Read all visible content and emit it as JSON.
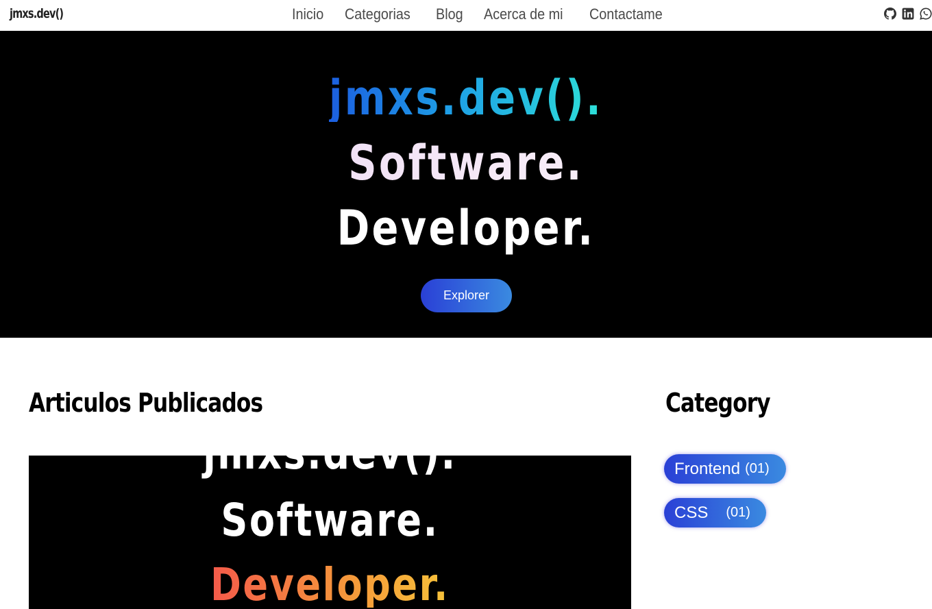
{
  "nav": {
    "brand": "jmxs.dev()",
    "links": [
      "Inicio",
      "Categorias",
      "Blog",
      "Acerca de mi",
      "Contactame"
    ],
    "icons": [
      "github-icon",
      "linkedin-icon",
      "whatsapp-icon"
    ]
  },
  "hero": {
    "line1": "jmxs.dev().",
    "line2": "Software.",
    "line3": "Developer.",
    "button": "Explorer"
  },
  "articles": {
    "title": "Articulos Publicados",
    "card": {
      "line1": "jmxs.dev().",
      "line2": "Software.",
      "line3": "Developer."
    }
  },
  "categories": {
    "title": "Category",
    "items": [
      {
        "name": "Frontend",
        "count": "(01)"
      },
      {
        "name": "CSS",
        "count": "(01)"
      }
    ]
  },
  "colors": {
    "hero_background": "#000000",
    "button_gradient_start": "#2a40d6",
    "button_gradient_end": "#3a8ae0",
    "hero_line1_gradient": [
      "#1c5fe0",
      "#2ee0d8"
    ],
    "card_line3_gradient": [
      "#f45a4a",
      "#f7c23a"
    ]
  }
}
